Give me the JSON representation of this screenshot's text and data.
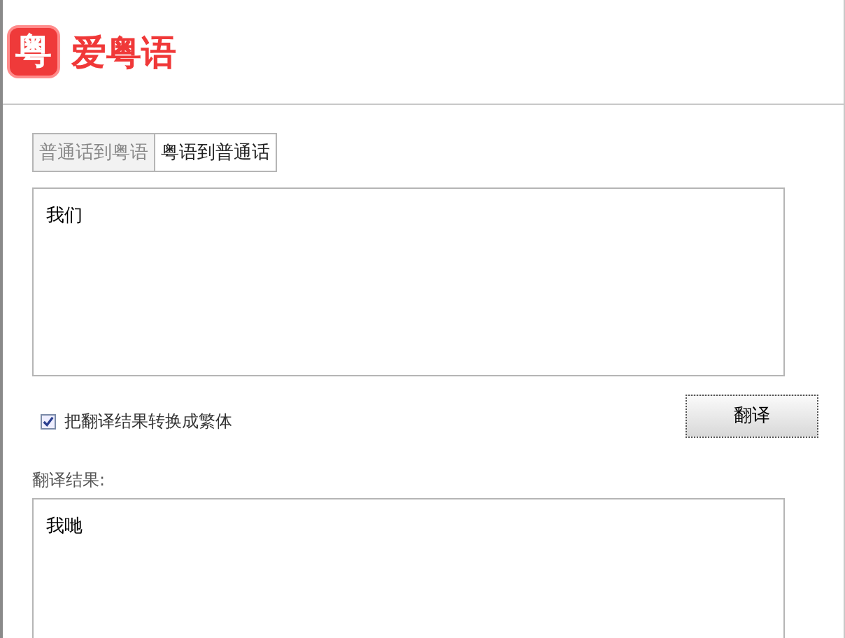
{
  "logo": {
    "glyph": "粤",
    "name": "爱粤语"
  },
  "tabs": [
    {
      "label": "普通话到粤语",
      "selected": true
    },
    {
      "label": "粤语到普通话",
      "selected": false
    }
  ],
  "input": {
    "value": "我们"
  },
  "traditional": {
    "label": "把翻译结果转换成繁体",
    "checked": true
  },
  "translate_button": "翻译",
  "result": {
    "label": "翻译结果:",
    "value": "我哋"
  }
}
